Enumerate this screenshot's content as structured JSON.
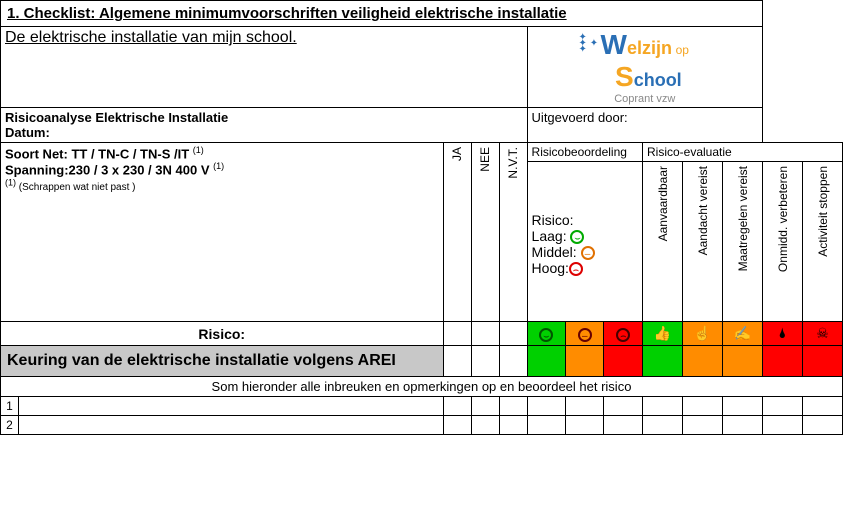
{
  "title": "1. Checklist: Algemene minimumvoorschriften veiligheid elektrische installatie",
  "subtitle": "De elektrische installatie van mijn school.",
  "logo": {
    "w": "W",
    "elzijn": "elzijn",
    "op": "op",
    "s": "S",
    "chool": "chool",
    "sub": "Coprant vzw"
  },
  "meta": {
    "analysis_label": "Risicoanalyse Elektrische Installatie",
    "date_label": "Datum:",
    "by_label": "Uitgevoerd door:"
  },
  "net": {
    "line1_label": "Soort Net: ",
    "line1_value": "TT / TN-C / TN-S  /IT",
    "line2_label": "Spanning:",
    "line2_value": "230 / 3 x 230 / 3N 400 V",
    "ref": "(1)",
    "note": "(Schrappen wat niet past )"
  },
  "cols": {
    "ja": "JA",
    "nee": "NEE",
    "nvt": "N.V.T."
  },
  "groups": {
    "assess": "Risicobeoordeling",
    "eval": "Risico-evaluatie"
  },
  "risk_legend": {
    "title": "Risico:",
    "low": "Laag:",
    "mid": "Middel:",
    "high": "Hoog:"
  },
  "eval_cols": {
    "c1": "Aanvaardbaar",
    "c2": "Aandacht vereist",
    "c3": "Maatregelen vereist",
    "c4": "Onmidd. verbeteren",
    "c5": "Activiteit stoppen"
  },
  "risk_label": "Risico:",
  "icons": {
    "smile": "☺",
    "neutral": "😐",
    "frown": "☹",
    "hand_ok": "☝",
    "hand_point": "☝",
    "hand_write": "✍",
    "drop": "💧",
    "skull": "☠"
  },
  "section_heading": "Keuring van de elektrische installatie volgens AREI",
  "instruction": "Som hieronder alle inbreuken en opmerkingen op en beoordeel het risico",
  "rows": {
    "r1": "1",
    "r2": "2"
  }
}
